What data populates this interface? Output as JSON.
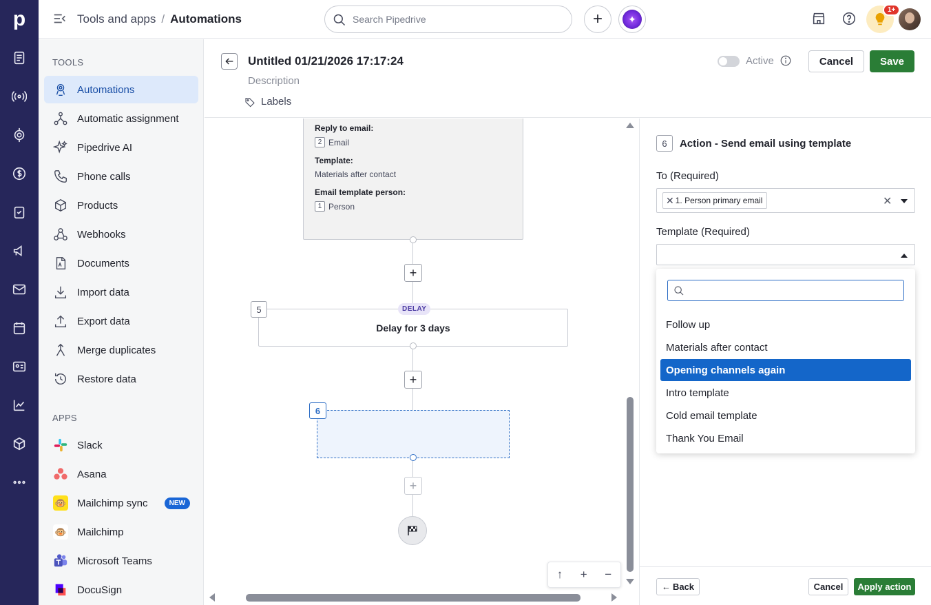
{
  "header": {
    "breadcrumb_parent": "Tools and apps",
    "breadcrumb_sep": "/",
    "breadcrumb_current": "Automations",
    "search_placeholder": "Search Pipedrive",
    "add_label": "+",
    "notification_badge": "1+"
  },
  "rail": {
    "logo": "p",
    "icons": [
      "leads-icon",
      "deals-icon",
      "projects-icon",
      "money-icon",
      "activities-icon",
      "campaigns-icon",
      "mail-icon",
      "calendar-icon",
      "contacts-icon",
      "insights-icon",
      "products-icon",
      "more-icon"
    ]
  },
  "sidebar": {
    "tools_heading": "TOOLS",
    "tools": [
      {
        "label": "Automations",
        "icon": "automation-icon",
        "active": true
      },
      {
        "label": "Automatic assignment",
        "icon": "assignment-icon"
      },
      {
        "label": "Pipedrive AI",
        "icon": "sparkle-icon"
      },
      {
        "label": "Phone calls",
        "icon": "phone-icon"
      },
      {
        "label": "Products",
        "icon": "box-icon"
      },
      {
        "label": "Webhooks",
        "icon": "webhook-icon"
      },
      {
        "label": "Documents",
        "icon": "document-icon"
      },
      {
        "label": "Import data",
        "icon": "download-icon"
      },
      {
        "label": "Export data",
        "icon": "upload-icon"
      },
      {
        "label": "Merge duplicates",
        "icon": "merge-icon"
      },
      {
        "label": "Restore data",
        "icon": "restore-icon"
      }
    ],
    "apps_heading": "APPS",
    "apps": [
      {
        "label": "Slack",
        "icon": "slack-icon"
      },
      {
        "label": "Asana",
        "icon": "asana-icon"
      },
      {
        "label": "Mailchimp sync",
        "icon": "mailchimp-icon",
        "badge": "NEW"
      },
      {
        "label": "Mailchimp",
        "icon": "mailchimp-icon"
      },
      {
        "label": "Microsoft Teams",
        "icon": "teams-icon"
      },
      {
        "label": "DocuSign",
        "icon": "docusign-icon"
      }
    ]
  },
  "editor": {
    "title": "Untitled 01/21/2026 17:17:24",
    "description": "Description",
    "labels": "Labels",
    "active_label": "Active",
    "cancel": "Cancel",
    "save": "Save"
  },
  "canvas": {
    "prev_card": {
      "reply_label": "Reply to email:",
      "reply_num": "2",
      "reply_value": "Email",
      "template_label": "Template:",
      "template_value": "Materials after contact",
      "person_label": "Email template person:",
      "person_num": "1",
      "person_value": "Person"
    },
    "delay_step_num": "5",
    "delay_tag": "DELAY",
    "delay_text": "Delay for 3 days",
    "action_step_num": "6",
    "zoom_controls": [
      "↑",
      "+",
      "−"
    ]
  },
  "panel": {
    "step_num": "6",
    "title": "Action - Send email using template",
    "to_label": "To (Required)",
    "to_chip": "1. Person primary email",
    "template_label": "Template (Required)",
    "search_placeholder": "",
    "options": [
      {
        "label": "Follow up",
        "selected": false
      },
      {
        "label": "Materials after contact",
        "selected": false
      },
      {
        "label": "Opening channels again",
        "selected": true
      },
      {
        "label": "Intro template",
        "selected": false
      },
      {
        "label": "Cold email template",
        "selected": false
      },
      {
        "label": "Thank You Email",
        "selected": false
      }
    ],
    "back": "Back",
    "cancel": "Cancel",
    "apply": "Apply action"
  },
  "colors": {
    "rail_bg": "#26265a",
    "save_green": "#2a7d36",
    "selected_blue": "#1466c9",
    "active_nav_bg": "#dde9fb"
  }
}
